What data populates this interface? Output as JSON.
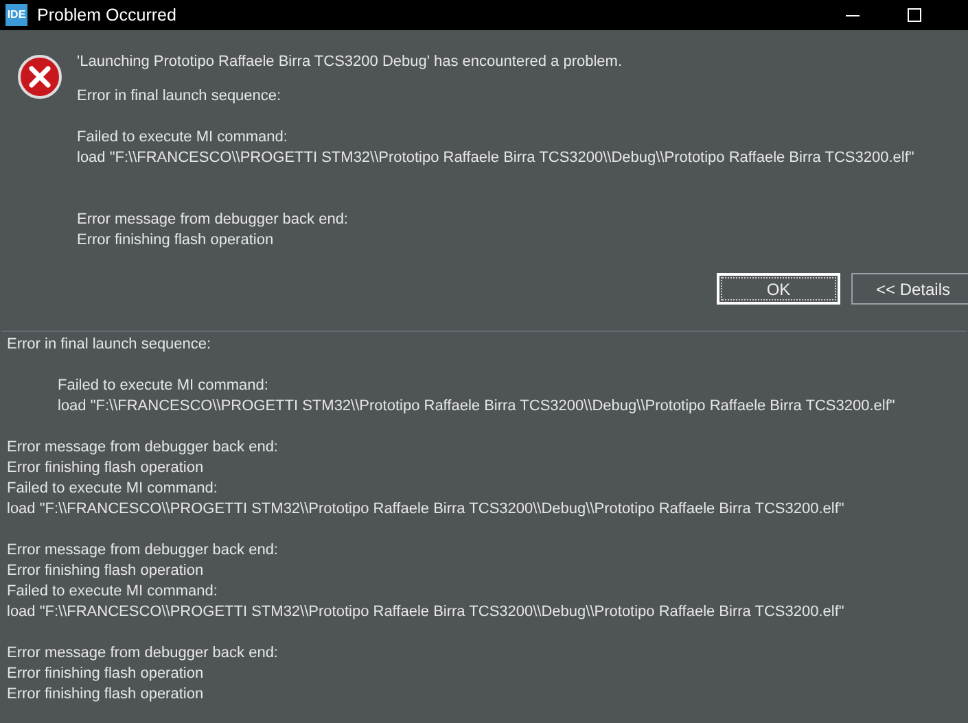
{
  "window": {
    "title": "Problem Occurred",
    "app_badge": "IDE"
  },
  "message": {
    "headline": "'Launching Prototipo Raffaele Birra TCS3200 Debug' has encountered a problem.",
    "paragraphs": [
      {
        "lines": [
          "Error in final launch sequence:"
        ]
      },
      {
        "lines": [
          "Failed to execute MI command:",
          "load \"F:\\\\FRANCESCO\\\\PROGETTI STM32\\\\Prototipo Raffaele Birra TCS3200\\\\Debug\\\\Prototipo Raffaele Birra TCS3200.elf\""
        ]
      },
      {
        "lines": [
          "Error message from debugger back end:",
          "Error finishing flash operation"
        ]
      }
    ]
  },
  "buttons": [
    {
      "label": "OK",
      "default": true
    },
    {
      "label": "<< Details",
      "default": false
    }
  ],
  "details": {
    "paragraphs": [
      {
        "indented": false,
        "lines": [
          "Error in final launch sequence:"
        ]
      },
      {
        "indented": true,
        "lines": [
          "Failed to execute MI command:",
          "load \"F:\\\\FRANCESCO\\\\PROGETTI STM32\\\\Prototipo Raffaele Birra TCS3200\\\\Debug\\\\Prototipo Raffaele Birra TCS3200.elf\""
        ]
      },
      {
        "indented": false,
        "lines": [
          "Error message from debugger back end:",
          "Error finishing flash operation",
          "Failed to execute MI command:",
          "load \"F:\\\\FRANCESCO\\\\PROGETTI STM32\\\\Prototipo Raffaele Birra TCS3200\\\\Debug\\\\Prototipo Raffaele Birra TCS3200.elf\""
        ]
      },
      {
        "indented": false,
        "lines": [
          "Error message from debugger back end:",
          "Error finishing flash operation",
          "Failed to execute MI command:",
          "load \"F:\\\\FRANCESCO\\\\PROGETTI STM32\\\\Prototipo Raffaele Birra TCS3200\\\\Debug\\\\Prototipo Raffaele Birra TCS3200.elf\""
        ]
      },
      {
        "indented": false,
        "lines": [
          "Error message from debugger back end:",
          "Error finishing flash operation",
          "Error finishing flash operation"
        ]
      }
    ]
  }
}
